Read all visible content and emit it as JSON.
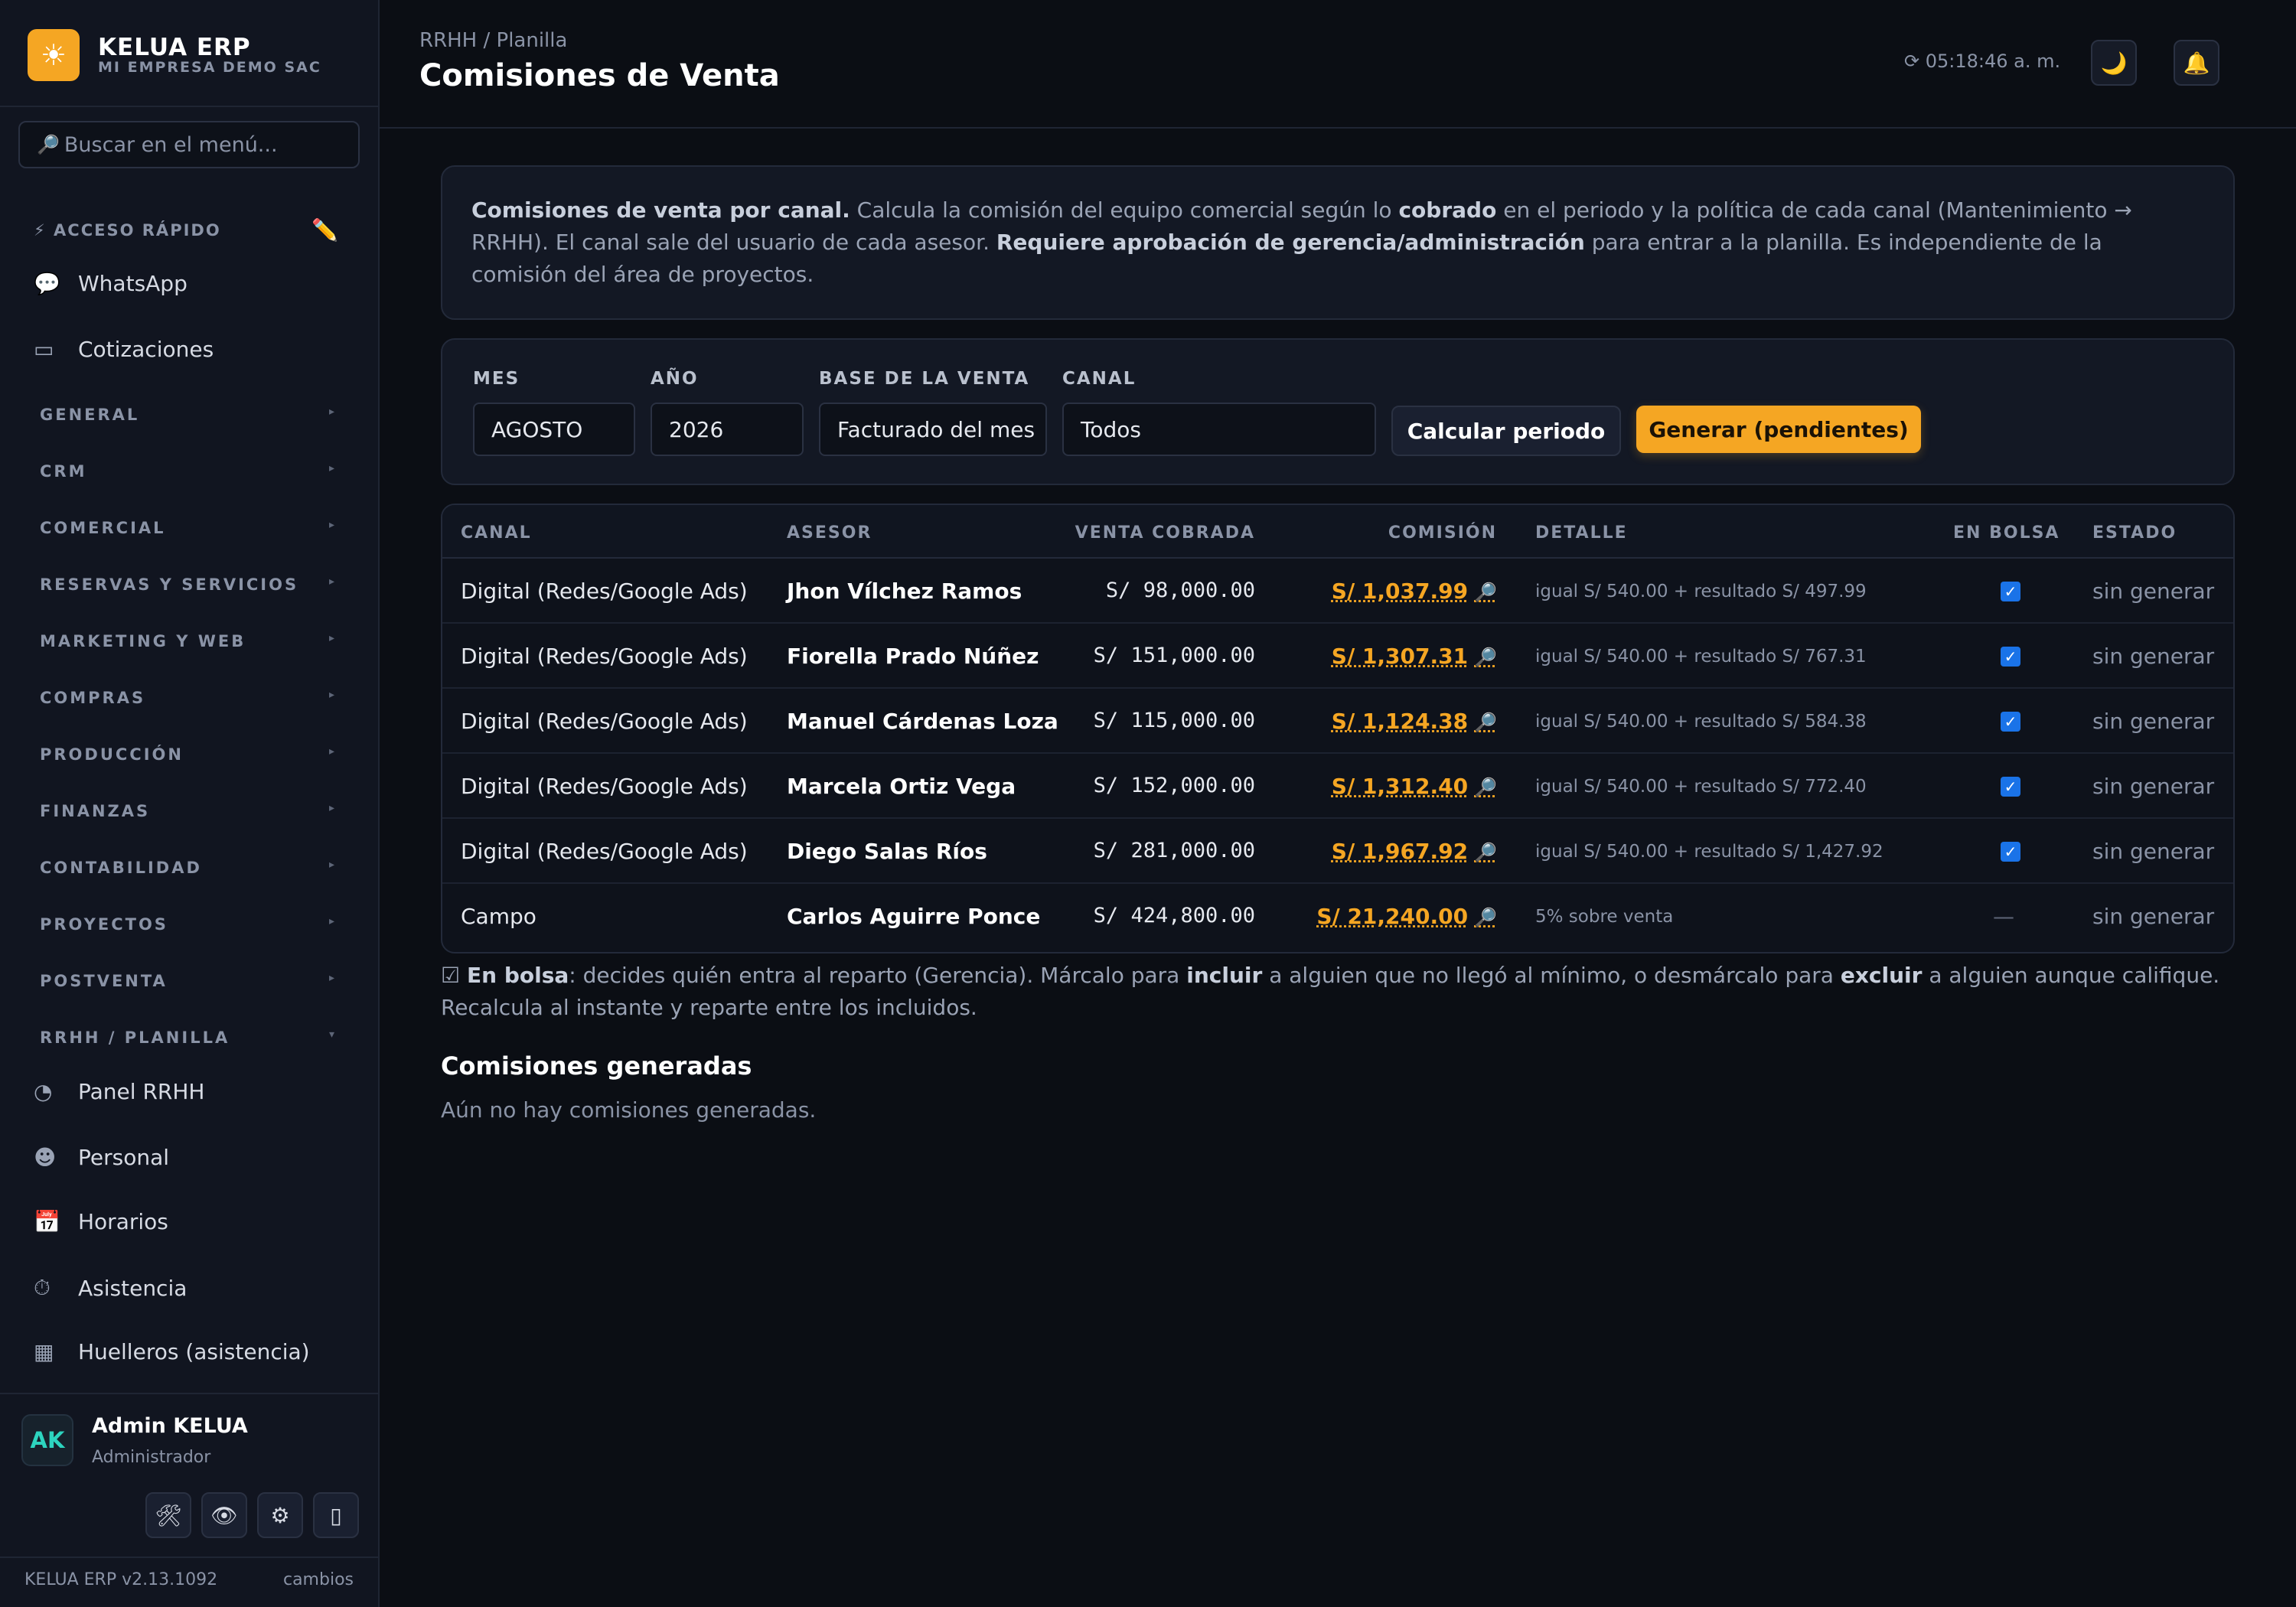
{
  "brand": {
    "name": "KELUA ERP",
    "company": "MI EMPRESA DEMO SAC",
    "logo_icon": "☀"
  },
  "sidebar": {
    "search_placeholder": "Buscar en el menú...",
    "quick_access_label": "⚡ ACCESO RÁPIDO",
    "quick_items": [
      {
        "label": "WhatsApp",
        "icon": "💬"
      },
      {
        "label": "Cotizaciones",
        "icon": "▭"
      }
    ],
    "sections": [
      "GENERAL",
      "CRM",
      "COMERCIAL",
      "RESERVAS Y SERVICIOS",
      "MARKETING Y WEB",
      "COMPRAS",
      "PRODUCCIÓN",
      "FINANZAS",
      "CONTABILIDAD",
      "PROYECTOS",
      "POSTVENTA",
      "RRHH / PLANILLA"
    ],
    "rrhh_items": [
      {
        "label": "Panel RRHH",
        "icon": "◔"
      },
      {
        "label": "Personal",
        "icon": "☻"
      },
      {
        "label": "Horarios",
        "icon": "📅"
      },
      {
        "label": "Asistencia",
        "icon": "⏱"
      },
      {
        "label": "Huelleros (asistencia)",
        "icon": "▦"
      }
    ],
    "user": {
      "initials": "AK",
      "name": "Admin KELUA",
      "role": "Administrador"
    },
    "version": "KELUA ERP v2.13.1092",
    "changes_link": "cambios"
  },
  "header": {
    "breadcrumb": "RRHH / Planilla",
    "title": "Comisiones de Venta",
    "clock": "⟳ 05:18:46 a. m."
  },
  "info": {
    "p1_bold": "Comisiones de venta por canal.",
    "p2": " Calcula la comisión del equipo comercial según lo ",
    "p3_bold": "cobrado",
    "p4": " en el periodo y la política de cada canal (Mantenimiento → RRHH). El canal sale del usuario de cada asesor. ",
    "p5_bold": "Requiere aprobación de gerencia/administración",
    "p6": " para entrar a la planilla. Es independiente de la comisión del área de proyectos."
  },
  "filters": {
    "mes_label": "MES",
    "mes_value": "AGOSTO",
    "anio_label": "AÑO",
    "anio_value": "2026",
    "base_label": "BASE DE LA VENTA",
    "base_value": "Facturado del mes",
    "canal_label": "CANAL",
    "canal_value": "Todos",
    "calc_button": "Calcular periodo",
    "gen_button": "Generar (pendientes)"
  },
  "table": {
    "headers": [
      "CANAL",
      "ASESOR",
      "VENTA COBRADA",
      "COMISIÓN",
      "DETALLE",
      "EN BOLSA",
      "ESTADO"
    ],
    "rows": [
      {
        "canal": "Digital (Redes/Google Ads)",
        "asesor": "Jhon Vílchez Ramos",
        "venta": "S/ 98,000.00",
        "comision": "S/ 1,037.99",
        "detalle": "igual S/ 540.00 + resultado S/ 497.99",
        "bolsa": true,
        "estado": "sin generar"
      },
      {
        "canal": "Digital (Redes/Google Ads)",
        "asesor": "Fiorella Prado Núñez",
        "venta": "S/ 151,000.00",
        "comision": "S/ 1,307.31",
        "detalle": "igual S/ 540.00 + resultado S/ 767.31",
        "bolsa": true,
        "estado": "sin generar"
      },
      {
        "canal": "Digital (Redes/Google Ads)",
        "asesor": "Manuel Cárdenas Loza",
        "venta": "S/ 115,000.00",
        "comision": "S/ 1,124.38",
        "detalle": "igual S/ 540.00 + resultado S/ 584.38",
        "bolsa": true,
        "estado": "sin generar"
      },
      {
        "canal": "Digital (Redes/Google Ads)",
        "asesor": "Marcela Ortiz Vega",
        "venta": "S/ 152,000.00",
        "comision": "S/ 1,312.40",
        "detalle": "igual S/ 540.00 + resultado S/ 772.40",
        "bolsa": true,
        "estado": "sin generar"
      },
      {
        "canal": "Digital (Redes/Google Ads)",
        "asesor": "Diego Salas Ríos",
        "venta": "S/ 281,000.00",
        "comision": "S/ 1,967.92",
        "detalle": "igual S/ 540.00 + resultado S/ 1,427.92",
        "bolsa": true,
        "estado": "sin generar"
      },
      {
        "canal": "Campo",
        "asesor": "Carlos Aguirre Ponce",
        "venta": "S/ 424,800.00",
        "comision": "S/ 21,240.00",
        "detalle": "5% sobre venta",
        "bolsa": false,
        "bolsa_text": "—",
        "estado": "sin generar"
      }
    ]
  },
  "note": {
    "n1": "☑ ",
    "n2_bold": "En bolsa",
    "n3": ": decides quién entra al reparto (Gerencia). Márcalo para ",
    "n4_bold": "incluir",
    "n5": " a alguien que no llegó al mínimo, o desmárcalo para ",
    "n6_bold": "excluir",
    "n7": " a alguien aunque califique. Recalcula al instante y reparte entre los incluidos."
  },
  "generated": {
    "title": "Comisiones generadas",
    "empty": "Aún no hay comisiones generadas."
  },
  "colors": {
    "accent": "#f5a623",
    "background": "#0b0e14",
    "checkbox": "#1a73e8"
  }
}
